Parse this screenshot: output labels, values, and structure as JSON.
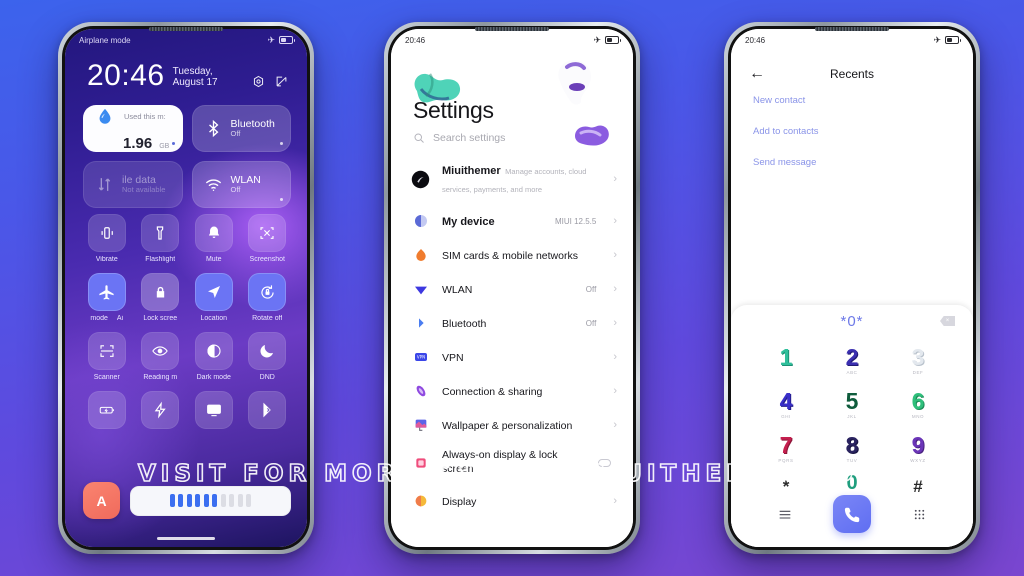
{
  "watermark": "VISIT FOR MORE THEMES    MIUITHEMER.COM",
  "theme": {
    "bg_start": "#3c63ec",
    "bg_end": "#7a46cf",
    "accent": "#6b74f4",
    "link": "#8a94e8"
  },
  "phone1": {
    "name": "control-center",
    "status": {
      "left": "Airplane mode",
      "time": "",
      "airplane_icon": "airplane-icon",
      "battery_icon": "battery-icon"
    },
    "clock": {
      "time": "20:46",
      "date": "Tuesday, August 17",
      "icon1": "settings-gear-icon",
      "icon2": "edit-icon"
    },
    "big_tiles": [
      {
        "name": "data-usage",
        "label": "Used this m:",
        "value": "1.96",
        "unit": "GB",
        "icon": "water-drop-icon",
        "style": "light"
      },
      {
        "name": "bluetooth",
        "title": "Bluetooth",
        "sub": "Off",
        "icon": "bluetooth-icon",
        "style": "normal"
      },
      {
        "name": "mobile-data",
        "title": "ile data",
        "sub": "Not available",
        "icon": "data-transfer-icon",
        "style": "dim"
      },
      {
        "name": "wlan",
        "title": "WLAN",
        "sub": "Off",
        "icon": "wifi-icon",
        "style": "normal"
      }
    ],
    "tiles": [
      {
        "label": "Vibrate",
        "icon": "vibrate-icon",
        "on": false
      },
      {
        "label": "Flashlight",
        "icon": "flashlight-icon",
        "on": false
      },
      {
        "label": "Mute",
        "icon": "bell-icon",
        "on": false
      },
      {
        "label": "Screenshot",
        "icon": "screenshot-icon",
        "on": false
      },
      {
        "label": "mode",
        "label2": "Ai",
        "icon": "airplane-icon",
        "on": true
      },
      {
        "label": "Lock scree",
        "icon": "lock-icon",
        "on": false,
        "pale": true
      },
      {
        "label": "Location",
        "icon": "location-arrow-icon",
        "on": true
      },
      {
        "label": "Rotate off",
        "icon": "rotate-lock-icon",
        "on": true
      },
      {
        "label": "Scanner",
        "icon": "scanner-icon",
        "on": false
      },
      {
        "label": "Reading m",
        "icon": "eye-icon",
        "on": false
      },
      {
        "label": "Dark mode",
        "icon": "contrast-icon",
        "on": false
      },
      {
        "label": "DND",
        "icon": "moon-icon",
        "on": false
      },
      {
        "label": "",
        "icon": "battery-saver-icon",
        "on": false
      },
      {
        "label": "",
        "icon": "lightning-icon",
        "on": false
      },
      {
        "label": "",
        "icon": "cast-screen-icon",
        "on": false
      },
      {
        "label": "",
        "icon": "second-space-icon",
        "on": false
      }
    ],
    "brightness": {
      "auto_label": "A",
      "segments_total": 10,
      "segments_filled": 6
    }
  },
  "phone2": {
    "name": "settings-app",
    "status": {
      "time": "20:46",
      "airplane_icon": "airplane-icon",
      "battery_icon": "battery-icon"
    },
    "title": "Settings",
    "search_placeholder": "Search settings",
    "search_icon": "search-icon",
    "account": {
      "name": "Miuithemer",
      "desc": "Manage accounts, cloud services, payments, and more",
      "avatar": "account-avatar"
    },
    "rows": [
      {
        "name": "My device",
        "value": "MIUI 12.5.5",
        "icon": "device-icon"
      },
      {
        "name": "SIM cards & mobile networks",
        "value": "",
        "icon": "sim-card-icon"
      },
      {
        "name": "WLAN",
        "value": "Off",
        "icon": "wifi-icon"
      },
      {
        "name": "Bluetooth",
        "value": "Off",
        "icon": "bluetooth-icon"
      },
      {
        "name": "VPN",
        "value": "",
        "icon": "vpn-icon"
      },
      {
        "name": "Connection & sharing",
        "value": "",
        "icon": "connection-sharing-icon"
      },
      {
        "name": "Wallpaper & personalization",
        "value": "",
        "icon": "wallpaper-icon"
      },
      {
        "name": "Always-on display & lock screen",
        "value": "",
        "icon": "lock-screen-icon",
        "toggle": true
      },
      {
        "name": "Display",
        "value": "",
        "icon": "display-icon"
      }
    ]
  },
  "phone3": {
    "name": "dialer-app",
    "status": {
      "time": "20:46",
      "airplane_icon": "airplane-icon",
      "battery_icon": "battery-icon"
    },
    "header": {
      "back_icon": "back-arrow-icon",
      "title": "Recents"
    },
    "links": [
      "New contact",
      "Add to contacts",
      "Send message"
    ],
    "dialpad": {
      "entered": "*0*",
      "delete_icon": "backspace-icon",
      "keys": [
        {
          "digit": "1",
          "sub": "",
          "color": "#2fbf9b"
        },
        {
          "digit": "2",
          "sub": "ABC",
          "color": "#3b2fb0"
        },
        {
          "digit": "3",
          "sub": "DEF",
          "color": "#d8dde4"
        },
        {
          "digit": "4",
          "sub": "GHI",
          "color": "#3a2fc9"
        },
        {
          "digit": "5",
          "sub": "JKL",
          "color": "#0f5c3c"
        },
        {
          "digit": "6",
          "sub": "MNO",
          "color": "#2fbf7b"
        },
        {
          "digit": "7",
          "sub": "PQRS",
          "color": "#c41f4e"
        },
        {
          "digit": "8",
          "sub": "TUV",
          "color": "#2a2360"
        },
        {
          "digit": "9",
          "sub": "WXYZ",
          "color": "#6b35b8"
        },
        {
          "digit": "*",
          "sub": "",
          "color": "#2a2a2a"
        },
        {
          "digit": "0",
          "sub": "+",
          "color": "#1f9e7e"
        },
        {
          "digit": "#",
          "sub": "",
          "color": "#2a2a2a"
        }
      ],
      "menu_icon": "menu-icon",
      "call_icon": "phone-call-icon",
      "keypad_icon": "keypad-grid-icon"
    }
  }
}
